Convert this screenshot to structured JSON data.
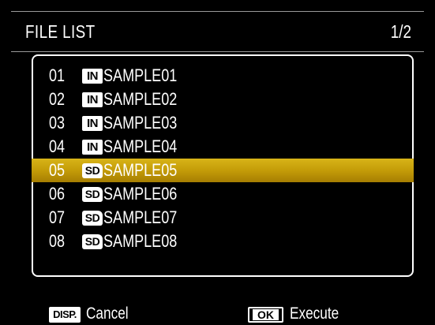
{
  "header": {
    "title": "FILE LIST",
    "page": "1/2"
  },
  "files": [
    {
      "num": "01",
      "storage": "IN",
      "name": "SAMPLE01",
      "selected": false
    },
    {
      "num": "02",
      "storage": "IN",
      "name": "SAMPLE02",
      "selected": false
    },
    {
      "num": "03",
      "storage": "IN",
      "name": "SAMPLE03",
      "selected": false
    },
    {
      "num": "04",
      "storage": "IN",
      "name": "SAMPLE04",
      "selected": false
    },
    {
      "num": "05",
      "storage": "SD",
      "name": "SAMPLE05",
      "selected": true
    },
    {
      "num": "06",
      "storage": "SD",
      "name": "SAMPLE06",
      "selected": false
    },
    {
      "num": "07",
      "storage": "SD",
      "name": "SAMPLE07",
      "selected": false
    },
    {
      "num": "08",
      "storage": "SD",
      "name": "SAMPLE08",
      "selected": false
    }
  ],
  "footer": {
    "disp_key": "DISP.",
    "cancel_label": "Cancel",
    "ok_key": "OK",
    "execute_label": "Execute"
  },
  "colors": {
    "background": "#000000",
    "text": "#ffffff",
    "highlight": "#c49c08"
  }
}
